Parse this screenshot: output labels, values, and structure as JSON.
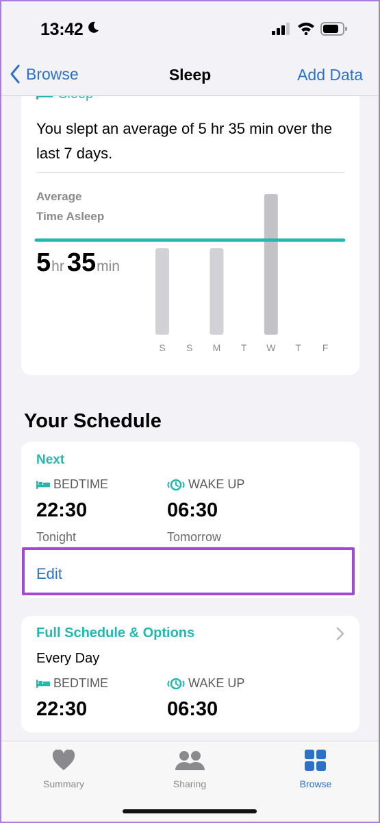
{
  "status_bar": {
    "time": "13:42"
  },
  "nav": {
    "back_label": "Browse",
    "title": "Sleep",
    "action_label": "Add Data"
  },
  "sleep_card": {
    "partial_label": "Sleep",
    "description": "You slept an average of 5 hr 35 min over the last 7 days.",
    "avg_label_1": "Average",
    "avg_label_2": "Time Asleep",
    "hours": "5",
    "hours_unit": "hr",
    "minutes": "35",
    "minutes_unit": "min"
  },
  "chart_data": {
    "type": "bar",
    "categories": [
      "S",
      "S",
      "M",
      "T",
      "W",
      "T",
      "F"
    ],
    "values": [
      5.1,
      0,
      5.1,
      0,
      8.3,
      0,
      0
    ],
    "average": 5.58,
    "average_color": "#22b8b0",
    "bar_color": "#d1d1d6",
    "highlight_color": "#c2c2c7",
    "ylim": [
      0,
      8.5
    ],
    "grid": false
  },
  "schedule": {
    "section_title": "Your Schedule",
    "next_label": "Next",
    "bedtime_label": "BEDTIME",
    "bedtime_time": "22:30",
    "bedtime_sub": "Tonight",
    "wakeup_label": "WAKE UP",
    "wakeup_time": "06:30",
    "wakeup_sub": "Tomorrow",
    "edit_label": "Edit"
  },
  "full_schedule": {
    "title": "Full Schedule & Options",
    "subtitle": "Every Day",
    "bedtime_label": "BEDTIME",
    "bedtime_time": "22:30",
    "wakeup_label": "WAKE UP",
    "wakeup_time": "06:30"
  },
  "tabs": [
    {
      "label": "Summary",
      "icon": "heart-icon"
    },
    {
      "label": "Sharing",
      "icon": "people-icon"
    },
    {
      "label": "Browse",
      "icon": "grid-icon",
      "active": true
    }
  ],
  "colors": {
    "accent": "#2b72c7",
    "teal": "#22b8b0",
    "highlight": "#a348d4"
  }
}
